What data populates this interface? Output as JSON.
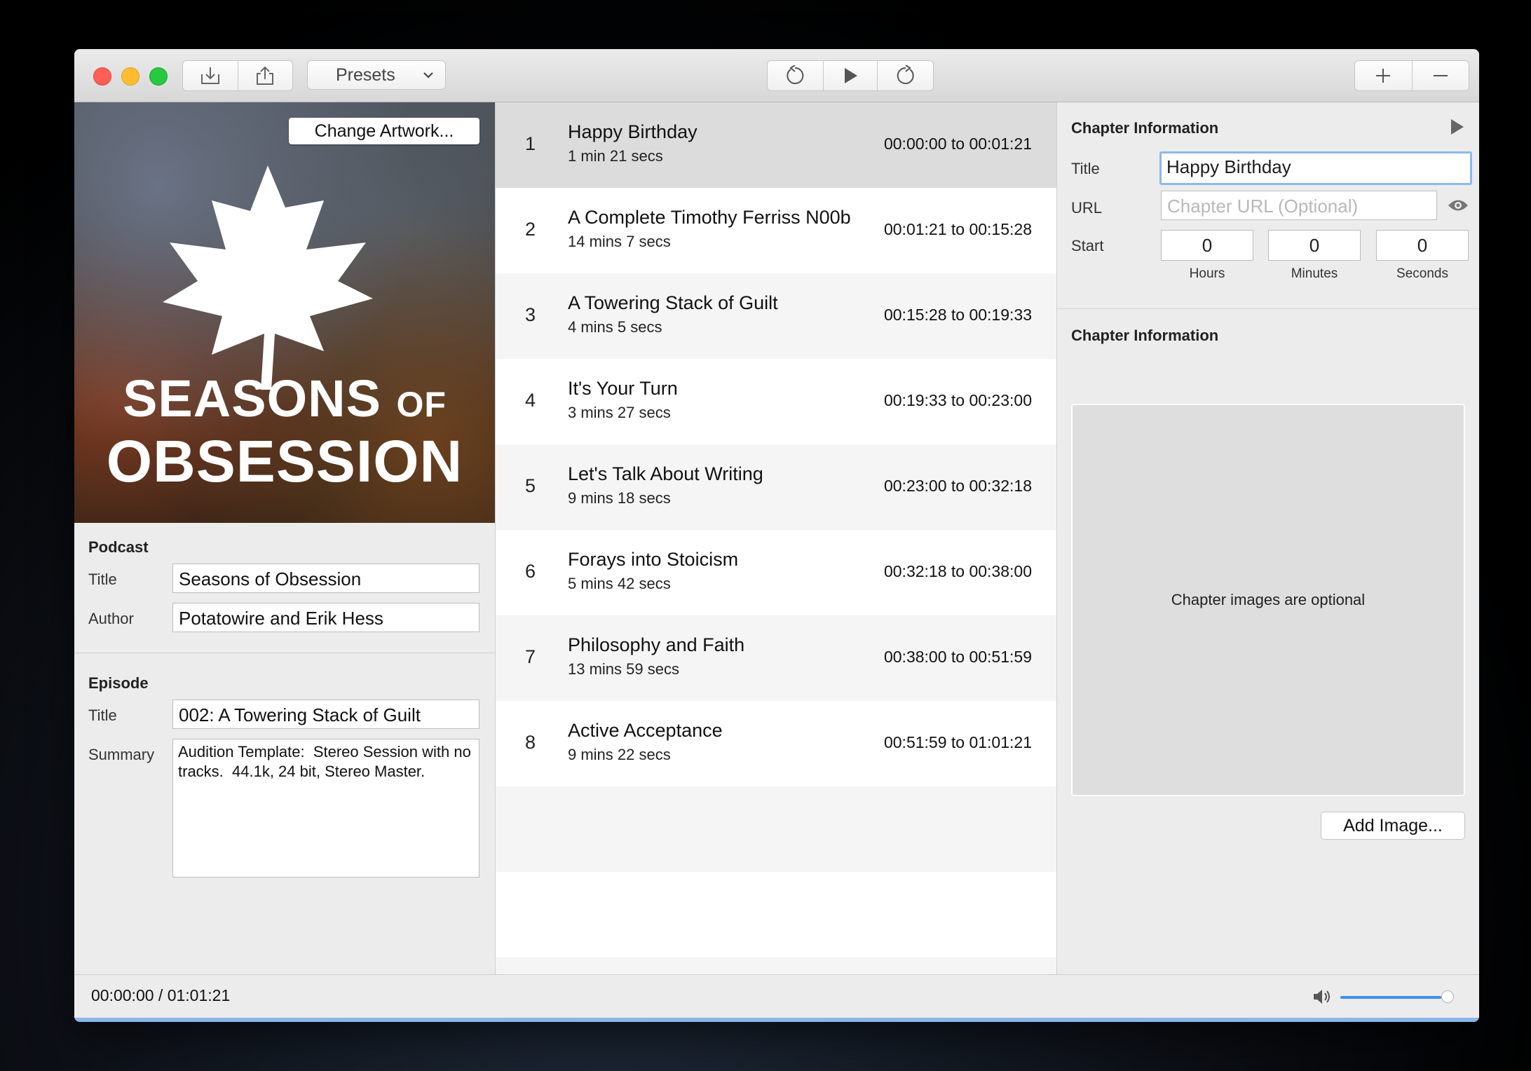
{
  "toolbar": {
    "presets_label": "Presets"
  },
  "artwork": {
    "change_label": "Change Artwork...",
    "logo_line1_big": "SEASONS",
    "logo_line1_small": "OF",
    "logo_line2": "OBSESSION"
  },
  "podcast": {
    "heading": "Podcast",
    "title_label": "Title",
    "title_value": "Seasons of Obsession",
    "author_label": "Author",
    "author_value": "Potatowire and Erik Hess"
  },
  "episode": {
    "heading": "Episode",
    "title_label": "Title",
    "title_value": "002: A Towering Stack of Guilt",
    "summary_label": "Summary",
    "summary_value": "Audition Template:  Stereo Session with no tracks.  44.1k, 24 bit, Stereo Master."
  },
  "chapters": [
    {
      "num": "1",
      "title": "Happy Birthday",
      "duration": "1 min 21 secs",
      "range": "00:00:00 to 00:01:21"
    },
    {
      "num": "2",
      "title": "A Complete Timothy Ferriss N00b",
      "duration": "14 mins 7 secs",
      "range": "00:01:21 to 00:15:28"
    },
    {
      "num": "3",
      "title": "A Towering Stack of Guilt",
      "duration": "4 mins 5 secs",
      "range": "00:15:28 to 00:19:33"
    },
    {
      "num": "4",
      "title": "It's Your Turn",
      "duration": "3 mins 27 secs",
      "range": "00:19:33 to 00:23:00"
    },
    {
      "num": "5",
      "title": "Let's Talk About Writing",
      "duration": "9 mins 18 secs",
      "range": "00:23:00 to 00:32:18"
    },
    {
      "num": "6",
      "title": "Forays into Stoicism",
      "duration": "5 mins 42 secs",
      "range": "00:32:18 to 00:38:00"
    },
    {
      "num": "7",
      "title": "Philosophy and Faith",
      "duration": "13 mins 59 secs",
      "range": "00:38:00 to 00:51:59"
    },
    {
      "num": "8",
      "title": "Active Acceptance",
      "duration": "9 mins 22 secs",
      "range": "00:51:59 to 01:01:21"
    }
  ],
  "chapter_info": {
    "heading": "Chapter Information",
    "title_label": "Title",
    "title_value": "Happy Birthday",
    "url_label": "URL",
    "url_placeholder": "Chapter URL (Optional)",
    "start_label": "Start",
    "hours_value": "0",
    "minutes_value": "0",
    "seconds_value": "0",
    "hours_label": "Hours",
    "minutes_label": "Minutes",
    "seconds_label": "Seconds"
  },
  "chapter_image": {
    "heading": "Chapter Information",
    "placeholder": "Chapter images are optional",
    "add_label": "Add Image..."
  },
  "status": {
    "time": "00:00:00 / 01:01:21",
    "volume_level": 0.9
  },
  "colors": {
    "accent": "#3d8ff0",
    "selected_row": "#dcdcdc"
  }
}
